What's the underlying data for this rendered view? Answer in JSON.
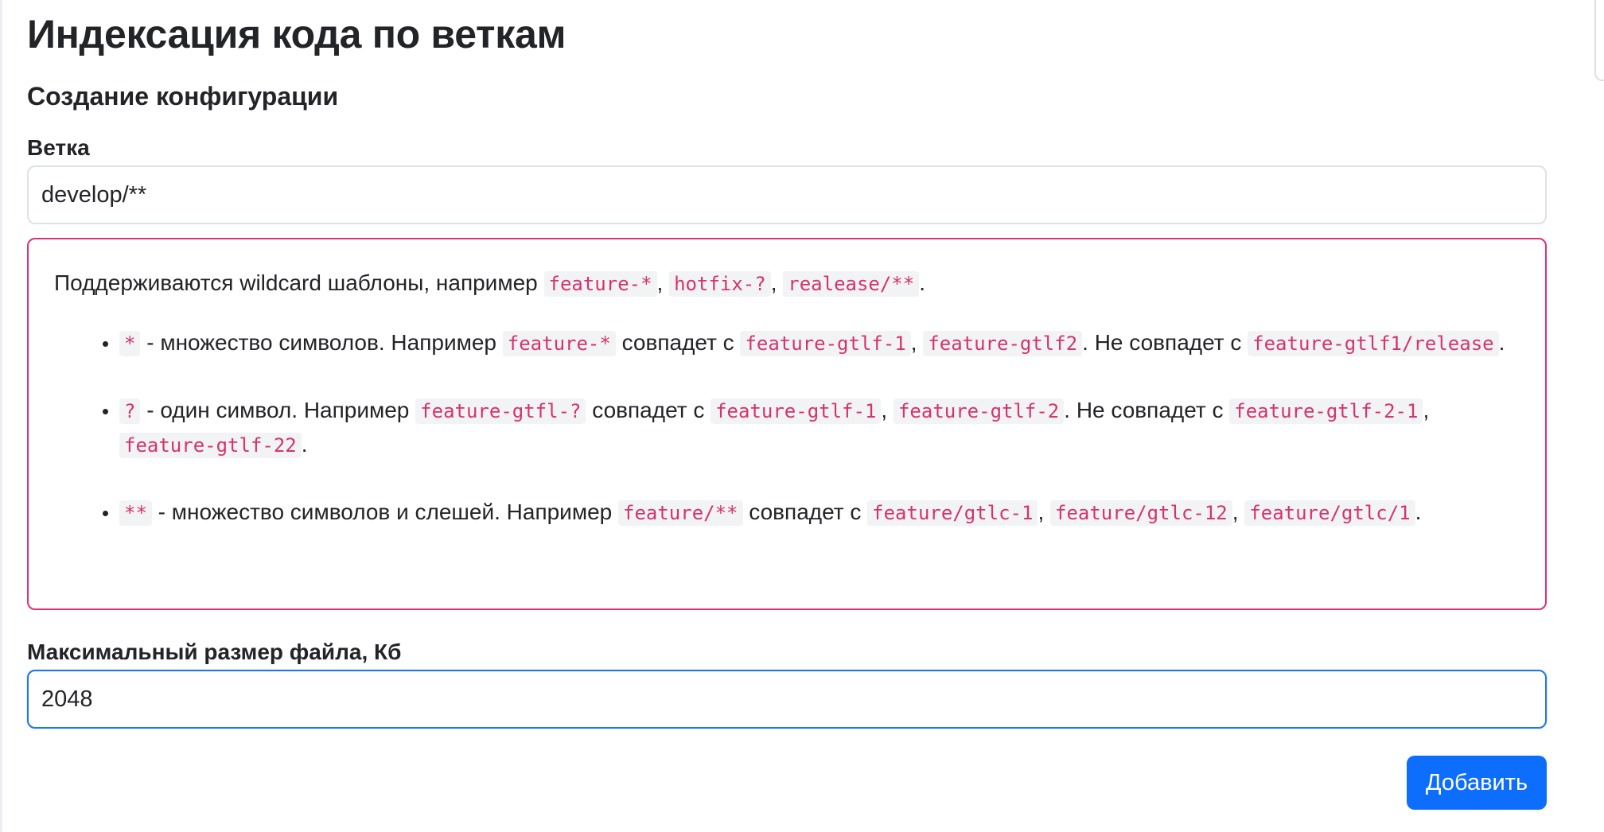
{
  "page": {
    "title": "Индексация кода по веткам",
    "section_title": "Создание конфигурации"
  },
  "branch_field": {
    "label": "Ветка",
    "value": "develop/**"
  },
  "help": {
    "intro_text": "Поддерживаются wildcard шаблоны, например ",
    "intro_examples": [
      "feature-*",
      "hotfix-?",
      "realease/**"
    ],
    "rules": [
      {
        "symbol": "*",
        "description": " - множество символов. Например ",
        "pattern": "feature-*",
        "matches_text": " совпадет с ",
        "matches": [
          "feature-gtlf-1",
          "feature-gtlf2"
        ],
        "no_match_text": ". Не совпадет с ",
        "no_matches": [
          "feature-gtlf1/release"
        ]
      },
      {
        "symbol": "?",
        "description": " - один символ. Например ",
        "pattern": "feature-gtfl-?",
        "matches_text": " совпадет с ",
        "matches": [
          "feature-gtlf-1",
          "feature-gtlf-2"
        ],
        "no_match_text": ". Не совпадет с ",
        "no_matches": [
          "feature-gtlf-2-1",
          "feature-gtlf-22"
        ]
      },
      {
        "symbol": "**",
        "description": " - множество символов и слешей. Например ",
        "pattern": "feature/**",
        "matches_text": " совпадет с ",
        "matches": [
          "feature/gtlc-1",
          "feature/gtlc-12",
          "feature/gtlc/1"
        ]
      }
    ]
  },
  "max_size_field": {
    "label": "Максимальный размер файла, Кб",
    "value": "2048"
  },
  "actions": {
    "submit_label": "Добавить"
  }
}
